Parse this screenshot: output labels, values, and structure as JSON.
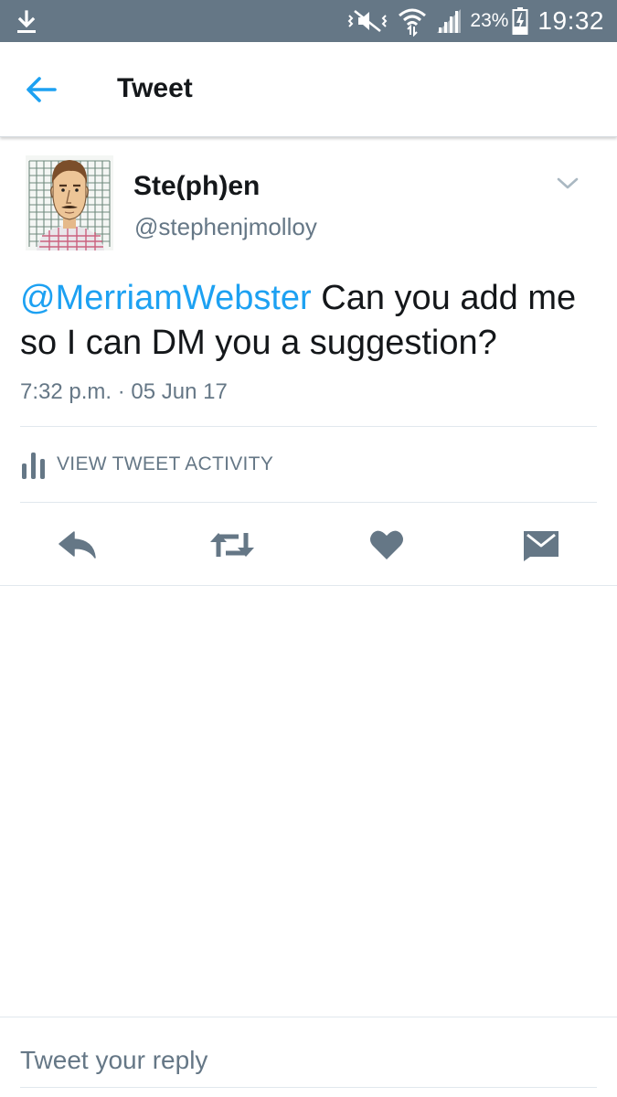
{
  "status_bar": {
    "battery_percent": "23%",
    "time": "19:32",
    "icons": [
      "download-icon",
      "mute-icon",
      "wifi-icon",
      "signal-icon",
      "battery-charging-icon"
    ]
  },
  "app_bar": {
    "title": "Tweet",
    "back_icon": "back-arrow-icon"
  },
  "tweet": {
    "author": {
      "display_name": "Ste(ph)en",
      "handle": "@stephenjmolloy"
    },
    "mention": "@MerriamWebster",
    "body": " Can you add me so I can DM you a suggestion?",
    "timestamp": "7:32 p.m. · 05 Jun 17",
    "activity_label": "VIEW TWEET ACTIVITY"
  },
  "actions": [
    "reply-icon",
    "retweet-icon",
    "like-icon",
    "direct-message-icon"
  ],
  "reply": {
    "placeholder": "Tweet your reply"
  },
  "colors": {
    "status_bar": "#657786",
    "accent": "#1da1f2",
    "secondary_text": "#657786",
    "action_icon": "#657786"
  }
}
